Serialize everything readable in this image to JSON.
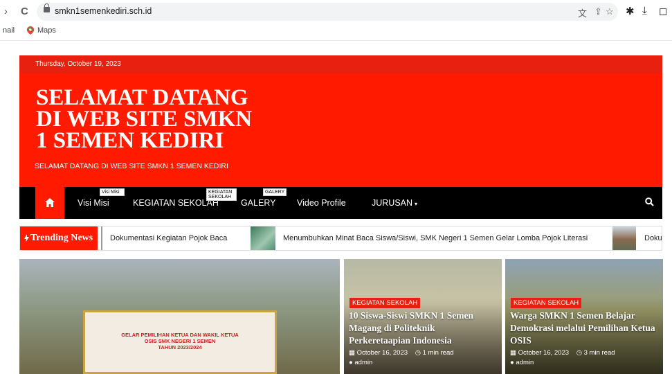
{
  "browser": {
    "url": "smkn1semenkediri.sch.id",
    "bookmarks": [
      "nail",
      "Maps"
    ]
  },
  "site": {
    "date": "Thursday, October 19, 2023",
    "title": "SELAMAT DATANG DI WEB SITE SMKN 1 SEMEN KEDIRI",
    "tagline": "SELAMAT DATANG DI WEB SITE SMKN 1 SEMEN KEDIRI"
  },
  "nav": {
    "items": [
      "Visi Misi",
      "KEGIATAN SEKOLAH",
      "GALERY",
      "Video Profile",
      "JURUSAN"
    ],
    "tooltips": [
      "Visi Misi",
      "KEGIATAN SEKOLAH",
      "GALERY"
    ]
  },
  "trending": {
    "label": "Trending News",
    "items": [
      "Dokumentasi Kegiatan Pojok Baca",
      "Menumbuhkan Minat Baca Siswa/Siswi, SMK Negeri 1 Semen Gelar Lomba Pojok Literasi",
      "Doku"
    ]
  },
  "features": {
    "banner_text": "GELAR PEMILIHAN KETUA DAN WAKIL KETUA\nOSIS SMK NEGERI 1 SEMEN\nTAHUN 2023/2024",
    "cards": [
      {
        "category": "KEGIATAN SEKOLAH",
        "title": "10 Siswa-Siswi SMKN 1 Semen Magang di Politeknik Perkeretaapian Indonesia",
        "date": "October 16, 2023",
        "read": "1 min read",
        "author": "admin"
      },
      {
        "category": "KEGIATAN SEKOLAH",
        "title": "Warga SMKN 1 Semen Belajar Demokrasi melalui Pemilihan Ketua OSIS",
        "date": "October 16, 2023",
        "read": "3 min read",
        "author": "admin"
      }
    ]
  },
  "colors": {
    "brand_red": "#ff1a00",
    "nav_black": "#000000"
  }
}
